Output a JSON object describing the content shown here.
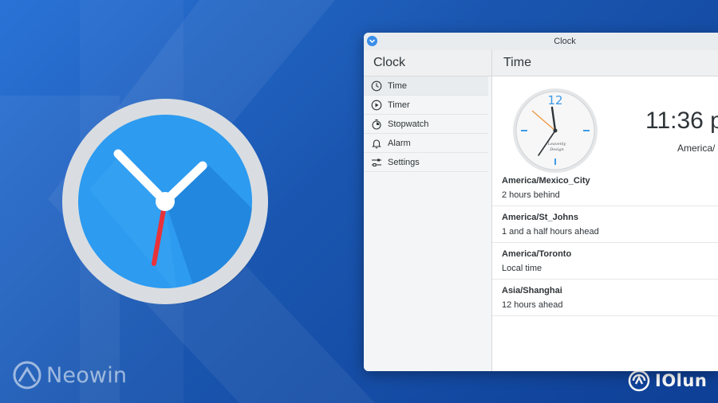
{
  "window": {
    "title": "Clock"
  },
  "sidebar": {
    "title": "Clock",
    "items": [
      {
        "label": "Time",
        "icon": "clock-icon",
        "active": true
      },
      {
        "label": "Timer",
        "icon": "timer-icon",
        "active": false
      },
      {
        "label": "Stopwatch",
        "icon": "stopwatch-icon",
        "active": false
      },
      {
        "label": "Alarm",
        "icon": "bell-icon",
        "active": false
      },
      {
        "label": "Settings",
        "icon": "sliders-icon",
        "active": false
      }
    ]
  },
  "main": {
    "title": "Time",
    "analog_clock": {
      "face_number": "12",
      "brand_line1": "Leavenly",
      "brand_line2": "Design"
    },
    "digital_time": "11:36 p",
    "timezone": "America/",
    "zones": [
      {
        "name": "America/Mexico_City",
        "difference": "2 hours behind"
      },
      {
        "name": "America/St_Johns",
        "difference": "1 and a half hours ahead"
      },
      {
        "name": "America/Toronto",
        "difference": "Local time"
      },
      {
        "name": "Asia/Shanghai",
        "difference": "12 hours ahead"
      }
    ]
  },
  "watermarks": {
    "left": "Neowin",
    "right": "IOlun"
  },
  "colors": {
    "background": "#1d5cb8",
    "accent": "#3b8ee8",
    "second_hand": "#e8323a",
    "clock_face": "#2d9bf0"
  }
}
